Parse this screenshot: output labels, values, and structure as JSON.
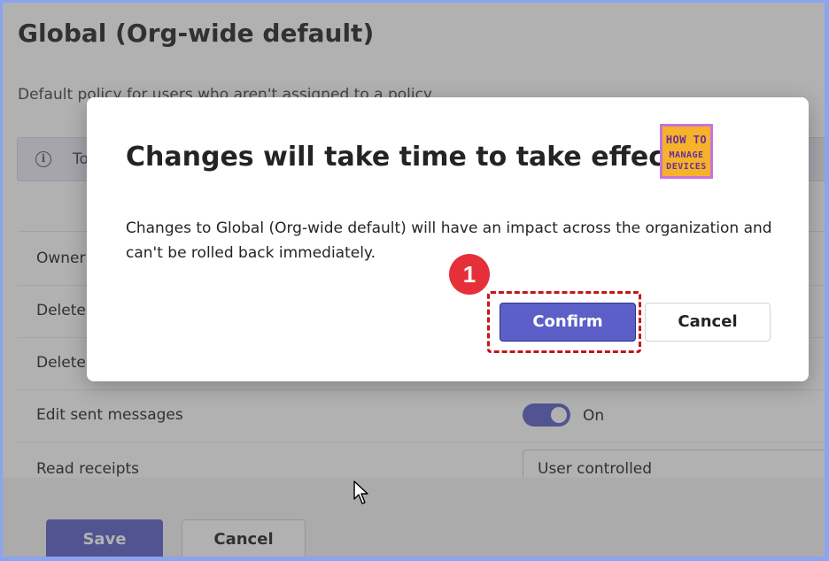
{
  "page": {
    "title": "Global (Org-wide default)",
    "subtitle": "Default policy for users who aren't assigned to a policy",
    "info_text": "To"
  },
  "settings": {
    "rows": [
      {
        "label": "Owner"
      },
      {
        "label": "Delete"
      },
      {
        "label": "Delete"
      },
      {
        "label": "Edit sent messages"
      },
      {
        "label": "Read receipts"
      }
    ],
    "edit_sent_messages_state": "On",
    "read_receipts_value": "User controlled"
  },
  "footer": {
    "save_label": "Save",
    "cancel_label": "Cancel"
  },
  "dialog": {
    "title": "Changes will take time to take effect",
    "body": "Changes to Global (Org-wide default) will have an impact across the organization and can't be rolled back immediately.",
    "confirm_label": "Confirm",
    "cancel_label": "Cancel",
    "logo": {
      "line1": "HOW TO",
      "line2": "MANAGE",
      "line3": "DEVICES"
    },
    "step_badge": "1"
  },
  "colors": {
    "accent": "#5b5fc7",
    "highlight": "#c4161c",
    "badge": "#e5303a",
    "frame": "#8ba4f0"
  }
}
